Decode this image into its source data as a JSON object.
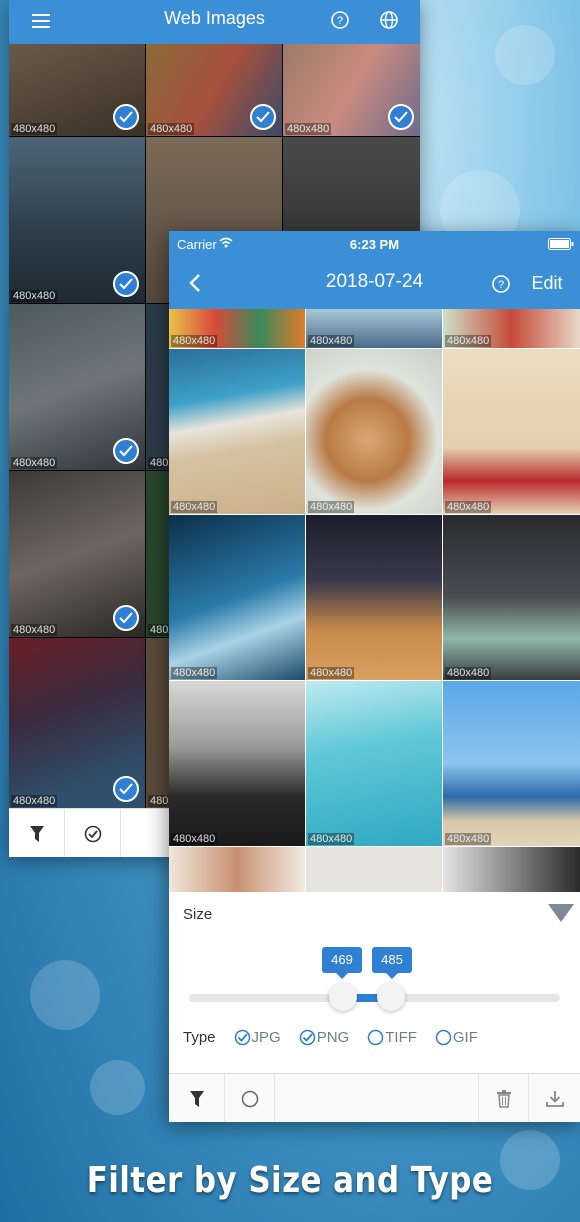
{
  "back_screen": {
    "title": "Web Images",
    "image_label": "480x480",
    "toolbar_icons": [
      "filter-icon",
      "checkmark-circle-icon"
    ]
  },
  "front_screen": {
    "status": {
      "carrier": "Carrier",
      "time": "6:23 PM"
    },
    "title": "2018-07-24",
    "edit_label": "Edit",
    "image_label": "480x480",
    "filter": {
      "size_label": "Size",
      "min_value": "469",
      "max_value": "485",
      "type_label": "Type",
      "types": [
        {
          "label": "JPG",
          "checked": true
        },
        {
          "label": "PNG",
          "checked": true
        },
        {
          "label": "TIFF",
          "checked": false
        },
        {
          "label": "GIF",
          "checked": false
        }
      ]
    }
  },
  "caption": "Filter by Size and Type",
  "colors": {
    "accent": "#3a8fd6",
    "check": "#2f7fd3"
  }
}
